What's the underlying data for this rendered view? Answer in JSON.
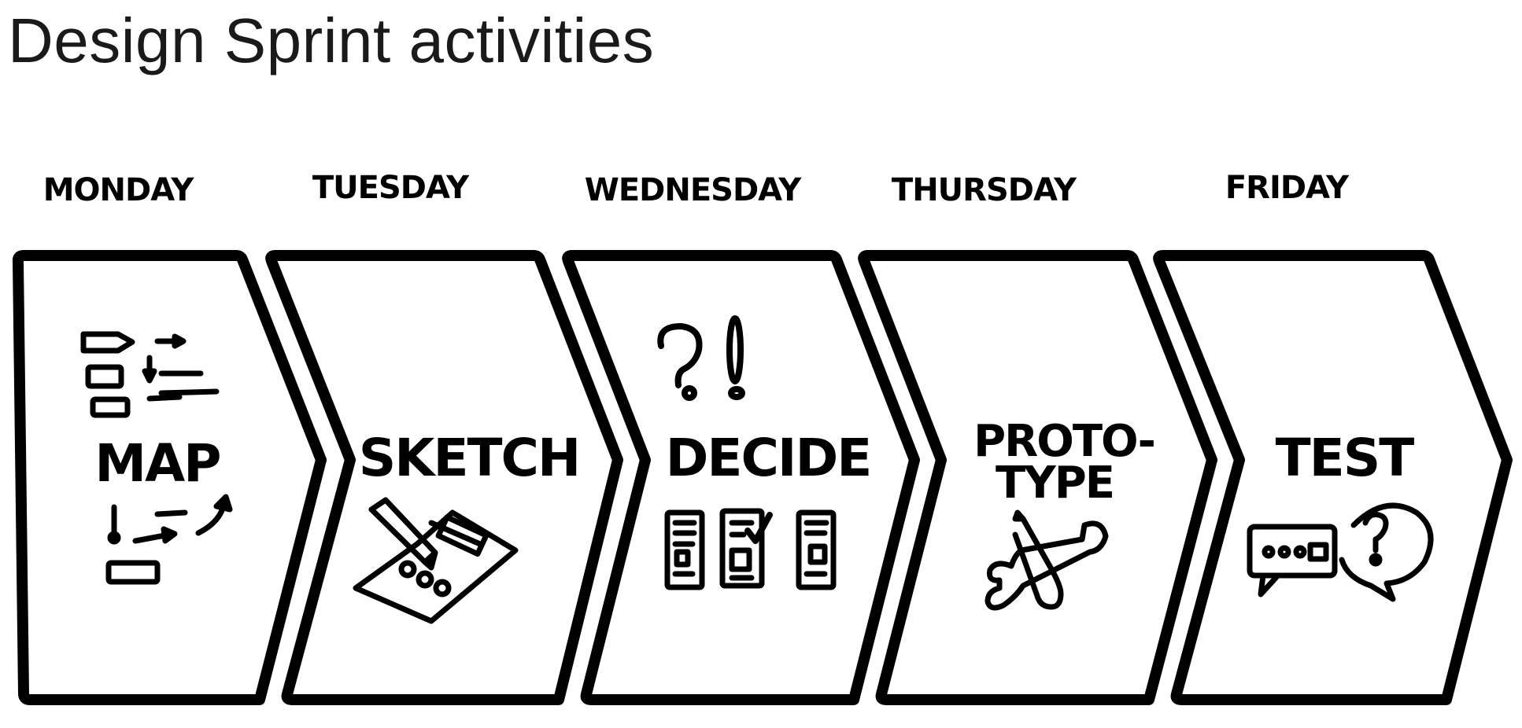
{
  "title": "Design Sprint activities",
  "stroke_color": "#000000",
  "days": [
    {
      "day": "MONDAY",
      "activity_lines": [
        "MAP"
      ],
      "icon": "flow-map-icon"
    },
    {
      "day": "TUESDAY",
      "activity_lines": [
        "SKETCH"
      ],
      "icon": "pencil-sketch-icon"
    },
    {
      "day": "WEDNESDAY",
      "activity_lines": [
        "DECIDE"
      ],
      "icon": "question-exclamation-icon"
    },
    {
      "day": "THURSDAY",
      "activity_lines": [
        "PROTO-",
        "TYPE"
      ],
      "icon": "wrench-screwdriver-icon"
    },
    {
      "day": "FRIDAY",
      "activity_lines": [
        "TEST"
      ],
      "icon": "speech-bubbles-icon"
    }
  ]
}
